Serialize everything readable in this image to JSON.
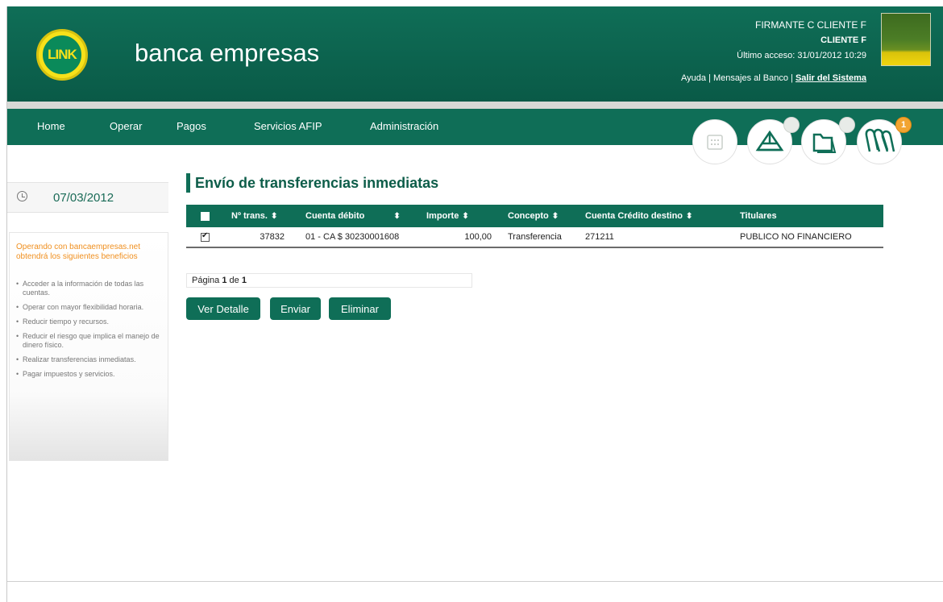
{
  "header": {
    "brand": "banca empresas",
    "logo_text": "LINK",
    "user_name": "FIRMANTE C CLIENTE F",
    "client_name": "CLIENTE F",
    "last_access": "Último acceso: 31/01/2012 10:29",
    "links": {
      "help": "Ayuda",
      "messages": "Mensajes al Banco",
      "logout": "Salir del Sistema",
      "sep": " | "
    }
  },
  "nav": {
    "items": [
      {
        "label": "Home"
      },
      {
        "label": "Operar"
      },
      {
        "label": "Pagos"
      },
      {
        "label": "Servicios AFIP"
      },
      {
        "label": "Administración"
      }
    ],
    "quick_icons": [
      "calendar-icon",
      "send-icon",
      "folder-icon",
      "clips-icon"
    ],
    "notification_count": "1"
  },
  "sidebar": {
    "date": "07/03/2012",
    "benefits_title": "Operando con bancaempresas.net obtendrá los siguientes beneficios",
    "benefits": [
      "Acceder a la información de todas las cuentas.",
      "Operar con mayor flexibilidad horaria.",
      "Reducir tiempo y recursos.",
      "Reducir el riesgo que implica el manejo de dinero físico.",
      "Realizar transferencias inmediatas.",
      "Pagar impuestos y servicios."
    ]
  },
  "main": {
    "title": "Envío de transferencias inmediatas",
    "table": {
      "headers": [
        "Nº trans.",
        "Cuenta débito",
        "Importe",
        "Concepto",
        "Cuenta Crédito destino",
        "Titulares"
      ],
      "sort_icon": "⬍",
      "rows": [
        {
          "checked": true,
          "num": "37832",
          "debit": "01 - CA $ 30230001608",
          "amount": "100,00",
          "concept": "Transferencia",
          "credit": "271211",
          "holders": "PUBLICO NO FINANCIERO"
        }
      ]
    },
    "pager": {
      "prefix": "Página",
      "current": "1",
      "of": "de",
      "total": "1"
    },
    "buttons": {
      "detail": "Ver Detalle",
      "send": "Enviar",
      "delete": "Eliminar"
    }
  },
  "colors": {
    "brand_green": "#0f6e57",
    "accent_orange": "#f09020",
    "badge": "#f2a431"
  }
}
